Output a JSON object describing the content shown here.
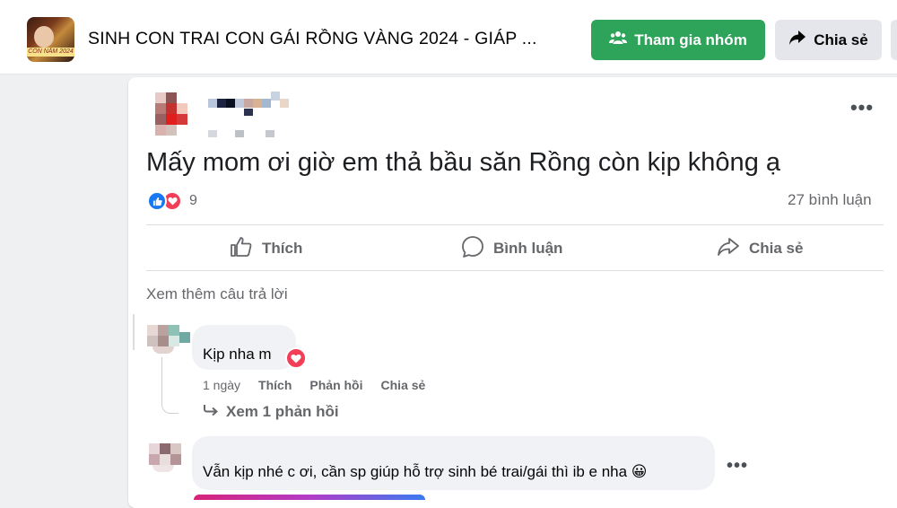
{
  "header": {
    "group_title": "SINH CON TRAI CON GÁI RỒNG VÀNG 2024 - GIÁP ...",
    "avatar_banner_text": "CON NĂM 2024",
    "join_button_label": "Tham gia nhóm",
    "share_button_label": "Chia sẻ",
    "join_icon": "group-users-icon",
    "share_icon": "share-arrow-icon"
  },
  "post": {
    "text": "Mấy mom ơi giờ em thả bầu săn Rồng còn kịp không ạ",
    "reaction_count": "9",
    "comment_count": "27 bình luận",
    "more_icon": "more-dots-icon",
    "actions": {
      "like": "Thích",
      "comment": "Bình luận",
      "share": "Chia sẻ"
    }
  },
  "comments_section": {
    "see_more_replies": "Xem thêm câu trả lời",
    "comments": [
      {
        "text": "Kịp nha m",
        "time": "1 ngày",
        "like": "Thích",
        "reply": "Phản hồi",
        "share": "Chia sẻ",
        "view_replies": "Xem 1 phản hồi"
      },
      {
        "text": "Vẫn kịp nhé c ơi, cần sp giúp hỗ trợ sinh bé trai/gái thì ib e nha 😀"
      }
    ]
  },
  "colors": {
    "join_green": "#2ea35a",
    "like_blue": "#1877f2",
    "love_red": "#f33e58",
    "muted_text": "#65676b",
    "bubble_bg": "#f0f2f5"
  }
}
